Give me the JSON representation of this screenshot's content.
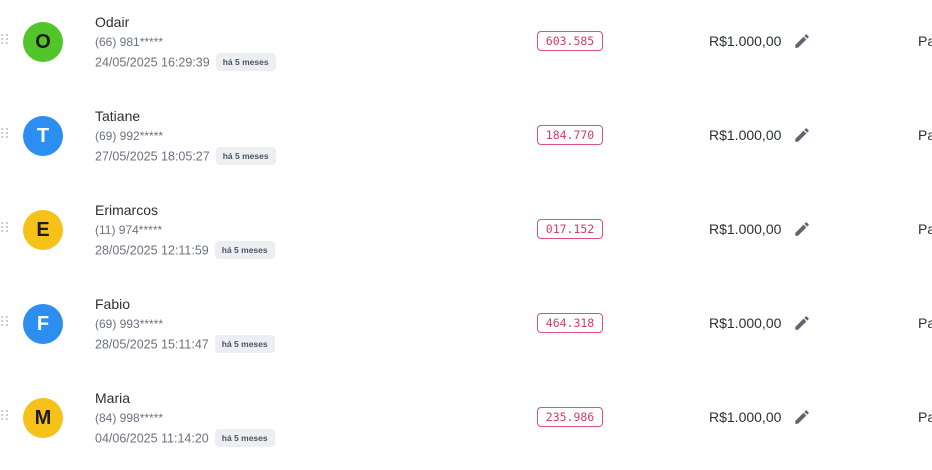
{
  "rows": [
    {
      "initial": "O",
      "avatar_color": "#52c52a",
      "avatar_text_color": "#1c1c1c",
      "name": "Odair",
      "phone": "(66) 981*****",
      "date": "24/05/2025 16:29:39",
      "badge": "há 5 meses",
      "code": "603.585",
      "amount": "R$1.000,00",
      "status": "Pa"
    },
    {
      "initial": "T",
      "avatar_color": "#2b8ef0",
      "avatar_text_color": "#ffffff",
      "name": "Tatiane",
      "phone": "(69) 992*****",
      "date": "27/05/2025 18:05:27",
      "badge": "há 5 meses",
      "code": "184.770",
      "amount": "R$1.000,00",
      "status": "Pa"
    },
    {
      "initial": "E",
      "avatar_color": "#f6c21a",
      "avatar_text_color": "#1c1c1c",
      "name": "Erimarcos",
      "phone": "(11) 974*****",
      "date": "28/05/2025 12:11:59",
      "badge": "há 5 meses",
      "code": "017.152",
      "amount": "R$1.000,00",
      "status": "Pa"
    },
    {
      "initial": "F",
      "avatar_color": "#2b8ef0",
      "avatar_text_color": "#ffffff",
      "name": "Fabio",
      "phone": "(69) 993*****",
      "date": "28/05/2025 15:11:47",
      "badge": "há 5 meses",
      "code": "464.318",
      "amount": "R$1.000,00",
      "status": "Pa"
    },
    {
      "initial": "M",
      "avatar_color": "#f6c21a",
      "avatar_text_color": "#1c1c1c",
      "name": "Maria",
      "phone": "(84) 998*****",
      "date": "04/06/2025 11:14:20",
      "badge": "há 5 meses",
      "code": "235.986",
      "amount": "R$1.000,00",
      "status": "Pa"
    }
  ],
  "icons": {
    "drag": "drag-handle-icon",
    "edit": "pencil-icon"
  }
}
